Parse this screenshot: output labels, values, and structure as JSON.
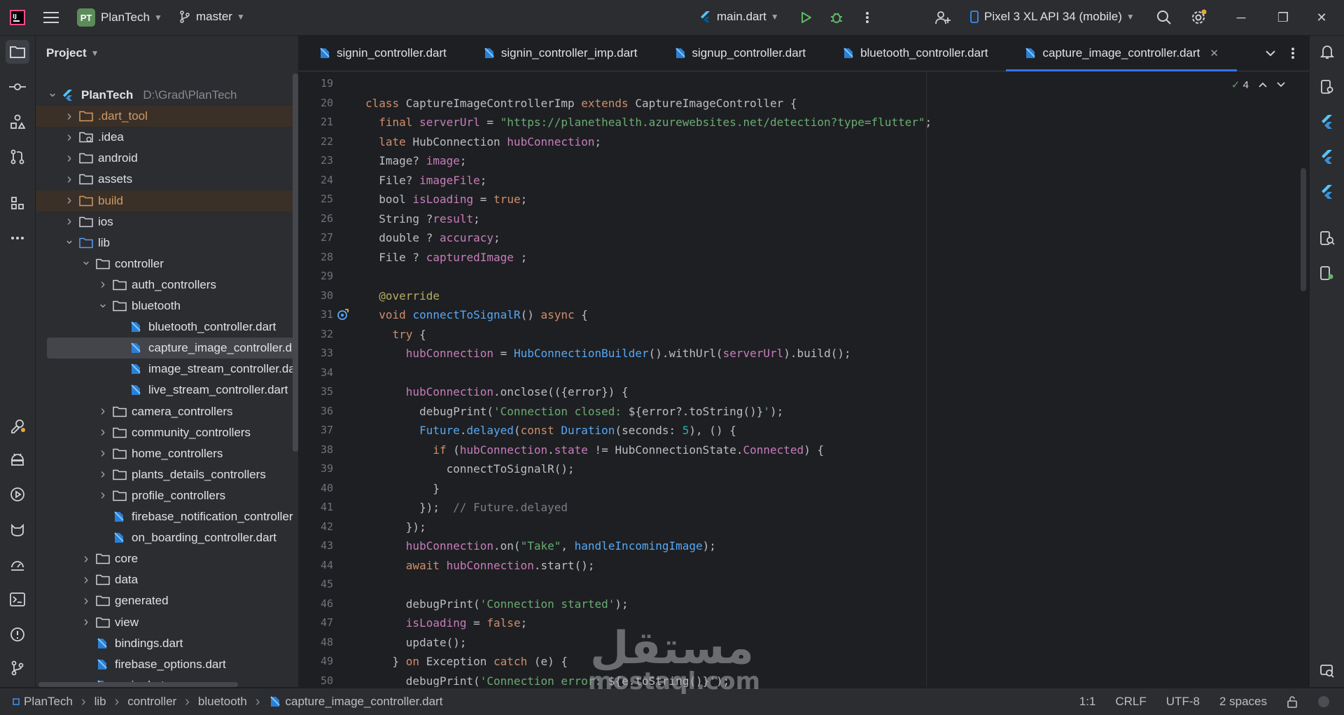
{
  "titlebar": {
    "project_initials": "PT",
    "project_name": "PlanTech",
    "branch": "master",
    "run_config": "main.dart",
    "device": "Pixel 3 XL API 34 (mobile)"
  },
  "project_panel": {
    "title": "Project",
    "tree": [
      {
        "label": "PlanTech",
        "sub": "D:\\Grad\\PlanTech",
        "icon": "flutter-project-icon",
        "arrow": "expanded"
      },
      {
        "label": ".dart_tool",
        "icon": "folder-icon",
        "arrow": "collapsed",
        "excluded": true
      },
      {
        "label": ".idea",
        "icon": "folder-settings-icon",
        "arrow": "collapsed"
      },
      {
        "label": "android",
        "icon": "folder-icon",
        "arrow": "collapsed"
      },
      {
        "label": "assets",
        "icon": "folder-icon",
        "arrow": "collapsed"
      },
      {
        "label": "build",
        "icon": "folder-icon",
        "arrow": "collapsed",
        "excluded": true
      },
      {
        "label": "ios",
        "icon": "folder-icon",
        "arrow": "collapsed"
      },
      {
        "label": "lib",
        "icon": "source-folder-icon",
        "arrow": "expanded"
      },
      {
        "label": "controller",
        "icon": "folder-icon",
        "arrow": "expanded"
      },
      {
        "label": "auth_controllers",
        "icon": "folder-icon",
        "arrow": "collapsed"
      },
      {
        "label": "bluetooth",
        "icon": "folder-icon",
        "arrow": "expanded"
      },
      {
        "label": "bluetooth_controller.dart",
        "icon": "dart-file-icon",
        "arrow": "none"
      },
      {
        "label": "capture_image_controller.da",
        "icon": "dart-file-icon",
        "arrow": "none",
        "selected": true
      },
      {
        "label": "image_stream_controller.dar",
        "icon": "dart-file-icon",
        "arrow": "none"
      },
      {
        "label": "live_stream_controller.dart",
        "icon": "dart-file-icon",
        "arrow": "none"
      },
      {
        "label": "camera_controllers",
        "icon": "folder-icon",
        "arrow": "collapsed"
      },
      {
        "label": "community_controllers",
        "icon": "folder-icon",
        "arrow": "collapsed"
      },
      {
        "label": "home_controllers",
        "icon": "folder-icon",
        "arrow": "collapsed"
      },
      {
        "label": "plants_details_controllers",
        "icon": "folder-icon",
        "arrow": "collapsed"
      },
      {
        "label": "profile_controllers",
        "icon": "folder-icon",
        "arrow": "collapsed"
      },
      {
        "label": "firebase_notification_controller",
        "icon": "dart-file-icon",
        "arrow": "none"
      },
      {
        "label": "on_boarding_controller.dart",
        "icon": "dart-file-icon",
        "arrow": "none"
      },
      {
        "label": "core",
        "icon": "folder-icon",
        "arrow": "collapsed"
      },
      {
        "label": "data",
        "icon": "folder-icon",
        "arrow": "collapsed"
      },
      {
        "label": "generated",
        "icon": "folder-icon",
        "arrow": "collapsed"
      },
      {
        "label": "view",
        "icon": "folder-icon",
        "arrow": "collapsed"
      },
      {
        "label": "bindings.dart",
        "icon": "dart-file-icon",
        "arrow": "none"
      },
      {
        "label": "firebase_options.dart",
        "icon": "dart-file-icon",
        "arrow": "none"
      },
      {
        "label": "main.dart",
        "icon": "dart-file-icon",
        "arrow": "none"
      }
    ]
  },
  "editor": {
    "tabs": [
      {
        "label": "signin_controller.dart",
        "active": false
      },
      {
        "label": "signin_controller_imp.dart",
        "active": false
      },
      {
        "label": "signup_controller.dart",
        "active": false
      },
      {
        "label": "bluetooth_controller.dart",
        "active": false
      },
      {
        "label": "capture_image_controller.dart",
        "active": true
      }
    ],
    "close_glyph": "✕",
    "inspection_count": "4",
    "first_line": 19,
    "lines": [
      [],
      [
        [
          "kw",
          "class "
        ],
        [
          "id",
          "CaptureImageControllerImp "
        ],
        [
          "kw",
          "extends "
        ],
        [
          "id",
          "CaptureImageController {"
        ]
      ],
      [
        [
          "id",
          "  "
        ],
        [
          "kw",
          "final "
        ],
        [
          "fld",
          "serverUrl"
        ],
        [
          "id",
          " = "
        ],
        [
          "str",
          "\"https://planethealth.azurewebsites.net/detection?type=flutter\""
        ],
        [
          "id",
          ";"
        ]
      ],
      [
        [
          "id",
          "  "
        ],
        [
          "kw",
          "late "
        ],
        [
          "id",
          "HubConnection "
        ],
        [
          "fld",
          "hubConnection"
        ],
        [
          "id",
          ";"
        ]
      ],
      [
        [
          "id",
          "  Image? "
        ],
        [
          "fld",
          "image"
        ],
        [
          "id",
          ";"
        ]
      ],
      [
        [
          "id",
          "  File? "
        ],
        [
          "fld",
          "imageFile"
        ],
        [
          "id",
          ";"
        ]
      ],
      [
        [
          "id",
          "  bool "
        ],
        [
          "fld",
          "isLoading"
        ],
        [
          "id",
          " = "
        ],
        [
          "kw",
          "true"
        ],
        [
          "id",
          ";"
        ]
      ],
      [
        [
          "id",
          "  String ?"
        ],
        [
          "fld",
          "result"
        ],
        [
          "id",
          ";"
        ]
      ],
      [
        [
          "id",
          "  double ? "
        ],
        [
          "fld",
          "accuracy"
        ],
        [
          "id",
          ";"
        ]
      ],
      [
        [
          "id",
          "  File ? "
        ],
        [
          "fld",
          "capturedImage"
        ],
        [
          "id",
          " ;"
        ]
      ],
      [],
      [
        [
          "id",
          "  "
        ],
        [
          "ann",
          "@override"
        ]
      ],
      [
        [
          "id",
          "  "
        ],
        [
          "kw",
          "void "
        ],
        [
          "fn",
          "connectToSignalR"
        ],
        [
          "id",
          "() "
        ],
        [
          "kw",
          "async "
        ],
        [
          "id",
          "{"
        ]
      ],
      [
        [
          "id",
          "    "
        ],
        [
          "kw",
          "try "
        ],
        [
          "id",
          "{"
        ]
      ],
      [
        [
          "id",
          "      "
        ],
        [
          "fld",
          "hubConnection"
        ],
        [
          "id",
          " = "
        ],
        [
          "fn",
          "HubConnectionBuilder"
        ],
        [
          "id",
          "().withUrl("
        ],
        [
          "fld",
          "serverUrl"
        ],
        [
          "id",
          ").build();"
        ]
      ],
      [],
      [
        [
          "id",
          "      "
        ],
        [
          "fld",
          "hubConnection"
        ],
        [
          "id",
          ".onclose(({error}) {"
        ]
      ],
      [
        [
          "id",
          "        debugPrint("
        ],
        [
          "str",
          "'Connection closed: "
        ],
        [
          "id",
          "${error?.toString()}"
        ],
        [
          "str",
          "'"
        ],
        [
          "id",
          ");"
        ]
      ],
      [
        [
          "id",
          "        "
        ],
        [
          "fn",
          "Future"
        ],
        [
          "id",
          "."
        ],
        [
          "fn",
          "delayed"
        ],
        [
          "id",
          "("
        ],
        [
          "kw",
          "const "
        ],
        [
          "fn",
          "Duration"
        ],
        [
          "id",
          "(seconds: "
        ],
        [
          "num",
          "5"
        ],
        [
          "id",
          "), () {"
        ]
      ],
      [
        [
          "id",
          "          "
        ],
        [
          "kw",
          "if "
        ],
        [
          "id",
          "("
        ],
        [
          "fld",
          "hubConnection"
        ],
        [
          "id",
          "."
        ],
        [
          "fld",
          "state"
        ],
        [
          "id",
          " != HubConnectionState."
        ],
        [
          "fld",
          "Connected"
        ],
        [
          "id",
          ") {"
        ]
      ],
      [
        [
          "id",
          "            connectToSignalR();"
        ]
      ],
      [
        [
          "id",
          "          }"
        ]
      ],
      [
        [
          "id",
          "        });  "
        ],
        [
          "cm",
          "// Future.delayed"
        ]
      ],
      [
        [
          "id",
          "      });"
        ]
      ],
      [
        [
          "id",
          "      "
        ],
        [
          "fld",
          "hubConnection"
        ],
        [
          "id",
          ".on("
        ],
        [
          "str",
          "\"Take\""
        ],
        [
          "id",
          ", "
        ],
        [
          "fn",
          "handleIncomingImage"
        ],
        [
          "id",
          ");"
        ]
      ],
      [
        [
          "id",
          "      "
        ],
        [
          "kw",
          "await "
        ],
        [
          "fld",
          "hubConnection"
        ],
        [
          "id",
          ".start();"
        ]
      ],
      [],
      [
        [
          "id",
          "      debugPrint("
        ],
        [
          "str",
          "'Connection started'"
        ],
        [
          "id",
          ");"
        ]
      ],
      [
        [
          "id",
          "      "
        ],
        [
          "fld",
          "isLoading"
        ],
        [
          "id",
          " = "
        ],
        [
          "kw",
          "false"
        ],
        [
          "id",
          ";"
        ]
      ],
      [
        [
          "id",
          "      update();"
        ]
      ],
      [
        [
          "id",
          "    } "
        ],
        [
          "kw",
          "on "
        ],
        [
          "id",
          "Exception "
        ],
        [
          "kw",
          "catch "
        ],
        [
          "id",
          "(e) {"
        ]
      ],
      [
        [
          "id",
          "      debugPrint("
        ],
        [
          "str",
          "'Connection error: "
        ],
        [
          "id",
          "${e.toString()}"
        ],
        [
          "str",
          "'"
        ],
        [
          "id",
          ");"
        ]
      ]
    ]
  },
  "statusbar": {
    "breadcrumbs": [
      "PlanTech",
      "lib",
      "controller",
      "bluetooth",
      "capture_image_controller.dart"
    ],
    "position": "1:1",
    "line_ending": "CRLF",
    "encoding": "UTF-8",
    "indent": "2 spaces"
  },
  "watermark": {
    "logo": "مستقل",
    "text": "mostaql.com"
  },
  "colors": {
    "background": "#1e1f22",
    "panel": "#2b2d30",
    "accent": "#3574f0",
    "keyword": "#cf8e6d",
    "field": "#c77dbb",
    "string": "#6aab73",
    "function": "#56a8f5",
    "annotation": "#b3ae60",
    "number": "#2aacb8",
    "comment": "#7a7e85",
    "excluded_folder": "#d19a66"
  }
}
